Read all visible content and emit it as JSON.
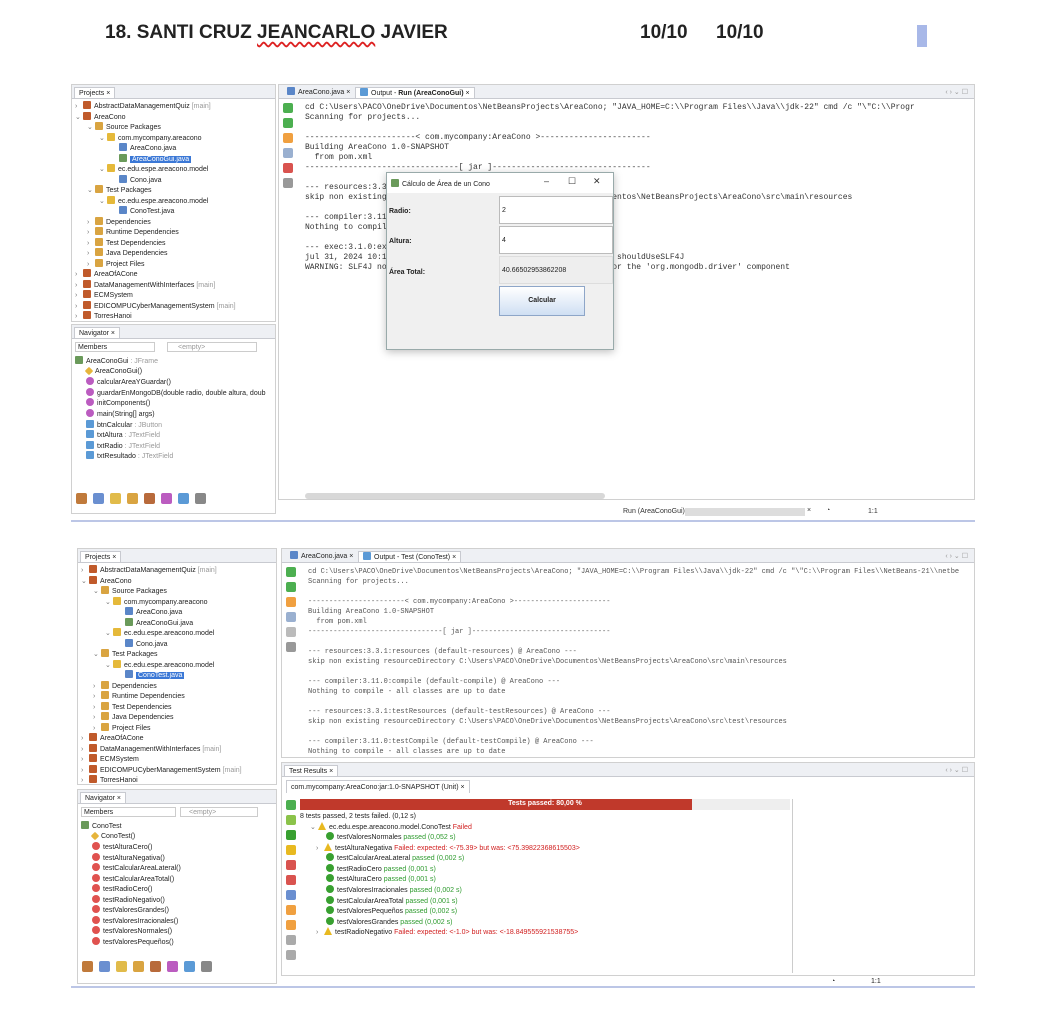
{
  "header": {
    "name_prefix": "18. SANTI CRUZ ",
    "name_underlined": "JEANCARLO",
    "name_suffix": " JAVIER",
    "grade1": "10/10",
    "grade2": "10/10"
  },
  "shot1": {
    "projects_tab": "Projects",
    "tree": [
      {
        "label": "AbstractDataManagementQuiz",
        "suffix": "[main]",
        "icon": "project-icon"
      },
      {
        "label": "AreaCono",
        "icon": "project-icon"
      },
      {
        "label": "Source Packages",
        "icon": "folder-icon"
      },
      {
        "label": "com.mycompany.areacono",
        "icon": "package-icon"
      },
      {
        "label": "AreaCono.java",
        "icon": "java-file-icon"
      },
      {
        "label": "AreaConoGui.java",
        "icon": "jframe-file-icon"
      },
      {
        "label": "ec.edu.espe.areacono.model",
        "icon": "package-icon"
      },
      {
        "label": "Cono.java",
        "icon": "java-file-icon"
      },
      {
        "label": "Test Packages",
        "icon": "folder-icon"
      },
      {
        "label": "ec.edu.espe.areacono.model",
        "icon": "package-icon"
      },
      {
        "label": "ConoTest.java",
        "icon": "java-file-icon"
      },
      {
        "label": "Dependencies",
        "icon": "library-icon"
      },
      {
        "label": "Runtime Dependencies",
        "icon": "library-icon"
      },
      {
        "label": "Test Dependencies",
        "icon": "library-icon"
      },
      {
        "label": "Java Dependencies",
        "icon": "library-icon"
      },
      {
        "label": "Project Files",
        "icon": "folder-icon"
      },
      {
        "label": "AreaOfACone",
        "icon": "project-icon"
      },
      {
        "label": "DataManagementWithInterfaces",
        "suffix": "[main]",
        "icon": "project-icon"
      },
      {
        "label": "ECMSystem",
        "icon": "project-icon"
      },
      {
        "label": "EDICOMPUCyberManagementSystem",
        "suffix": "[main]",
        "icon": "project-icon"
      },
      {
        "label": "TorresHanoi",
        "icon": "project-icon"
      }
    ],
    "navigator_tab": "Navigator",
    "members_label": "Members",
    "members_filter": "<empty>",
    "nav_items": [
      {
        "label": "AreaConoGui",
        "type": " : JFrame"
      },
      {
        "label": "AreaConoGui()",
        "type": ""
      },
      {
        "label": "calcularAreaYGuardar()",
        "type": ""
      },
      {
        "label": "guardarEnMongoDB(double radio, double altura, doub",
        "type": ""
      },
      {
        "label": "initComponents()",
        "type": ""
      },
      {
        "label": "main(String[] args)",
        "type": ""
      },
      {
        "label": "btnCalcular",
        "type": " : JButton"
      },
      {
        "label": "txtAltura",
        "type": " : JTextField"
      },
      {
        "label": "txtRadio",
        "type": " : JTextField"
      },
      {
        "label": "txtResultado",
        "type": " : JTextField"
      }
    ],
    "editor_tabs": [
      "AreaCono.java",
      "Output - "
    ],
    "output_tab_bold": "Run (AreaConoGui)",
    "output_lines": [
      "cd C:\\Users\\PACO\\OneDrive\\Documentos\\NetBeansProjects\\AreaCono; \"JAVA_HOME=C:\\\\Program Files\\\\Java\\\\jdk-22\" cmd /c \"\\\"C:\\\\Progr",
      "Scanning for projects...",
      "",
      "-----------------------< com.mycompany:AreaCono >-----------------------",
      "Building AreaCono 1.0-SNAPSHOT",
      "  from pom.xml",
      "--------------------------------[ jar ]---------------------------------",
      "",
      "--- resources:3.3.1:resources (default-resources) @ AreaCono ---",
      "skip non existing resourceDirectory C:\\Users\\PACO\\OneDrive\\Documentos\\NetBeansProjects\\AreaCono\\src\\main\\resources",
      "",
      "--- compiler:3.11.0:compile (default-compile) @ AreaCono ---",
      "Nothing to compile - all classes are up to date",
      "",
      "--- exec:3.1.0:exec (default-cli) @ AreaCono ---",
      "jul 31, 2024 10:13:44 AM com.mongodb.diagnostics.logging.Loggers shouldUseSLF4J",
      "WARNING: SLF4J not found on the classpath. Logging is disabled for the 'org.mongodb.driver' component"
    ],
    "dialog": {
      "title": "Cálculo de Área de un Cono",
      "radio_label": "Radio:",
      "radio_value": "2",
      "altura_label": "Altura:",
      "altura_value": "4",
      "area_label": "Área Total:",
      "area_value": "40.66502953862208",
      "button": "Calcular"
    },
    "status_run": "Run (AreaConoGui)",
    "status_pos": "1:1"
  },
  "shot2": {
    "projects_tab": "Projects",
    "tree": [
      {
        "label": "AbstractDataManagementQuiz",
        "suffix": "[main]",
        "icon": "project-icon"
      },
      {
        "label": "AreaCono",
        "icon": "project-icon"
      },
      {
        "label": "Source Packages",
        "icon": "folder-icon"
      },
      {
        "label": "com.mycompany.areacono",
        "icon": "package-icon"
      },
      {
        "label": "AreaCono.java",
        "icon": "java-file-icon"
      },
      {
        "label": "AreaConoGui.java",
        "icon": "jframe-file-icon"
      },
      {
        "label": "ec.edu.espe.areacono.model",
        "icon": "package-icon"
      },
      {
        "label": "Cono.java",
        "icon": "java-file-icon"
      },
      {
        "label": "Test Packages",
        "icon": "folder-icon"
      },
      {
        "label": "ec.edu.espe.areacono.model",
        "icon": "package-icon"
      },
      {
        "label": "ConoTest.java",
        "icon": "java-file-icon"
      },
      {
        "label": "Dependencies",
        "icon": "library-icon"
      },
      {
        "label": "Runtime Dependencies",
        "icon": "library-icon"
      },
      {
        "label": "Test Dependencies",
        "icon": "library-icon"
      },
      {
        "label": "Java Dependencies",
        "icon": "library-icon"
      },
      {
        "label": "Project Files",
        "icon": "folder-icon"
      },
      {
        "label": "AreaOfACone",
        "icon": "project-icon"
      },
      {
        "label": "DataManagementWithInterfaces",
        "suffix": "[main]",
        "icon": "project-icon"
      },
      {
        "label": "ECMSystem",
        "icon": "project-icon"
      },
      {
        "label": "EDICOMPUCyberManagementSystem",
        "suffix": "[main]",
        "icon": "project-icon"
      },
      {
        "label": "TorresHanoi",
        "icon": "project-icon"
      }
    ],
    "navigator_tab": "Navigator",
    "members_label": "Members",
    "members_filter": "<empty>",
    "nav_items": [
      "ConoTest",
      "ConoTest()",
      "testAlturaCero()",
      "testAlturaNegativa()",
      "testCalcularAreaLateral()",
      "testCalcularAreaTotal()",
      "testRadioCero()",
      "testRadioNegativo()",
      "testValoresGrandes()",
      "testValoresIrracionales()",
      "testValoresNormales()",
      "testValoresPequeños()"
    ],
    "editor_tabs": [
      "AreaCono.java",
      "Output - Test (ConoTest)"
    ],
    "output_lines": [
      "cd C:\\Users\\PACO\\OneDrive\\Documentos\\NetBeansProjects\\AreaCono; \"JAVA_HOME=C:\\\\Program Files\\\\Java\\\\jdk-22\" cmd /c \"\\\"C:\\\\Program Files\\\\NetBeans-21\\\\netbe",
      "Scanning for projects...",
      "",
      "-----------------------< com.mycompany:AreaCono >-----------------------",
      "Building AreaCono 1.0-SNAPSHOT",
      "  from pom.xml",
      "--------------------------------[ jar ]---------------------------------",
      "",
      "--- resources:3.3.1:resources (default-resources) @ AreaCono ---",
      "skip non existing resourceDirectory C:\\Users\\PACO\\OneDrive\\Documentos\\NetBeansProjects\\AreaCono\\src\\main\\resources",
      "",
      "--- compiler:3.11.0:compile (default-compile) @ AreaCono ---",
      "Nothing to compile - all classes are up to date",
      "",
      "--- resources:3.3.1:testResources (default-testResources) @ AreaCono ---",
      "skip non existing resourceDirectory C:\\Users\\PACO\\OneDrive\\Documentos\\NetBeansProjects\\AreaCono\\src\\test\\resources",
      "",
      "--- compiler:3.11.0:testCompile (default-testCompile) @ AreaCono ---",
      "Nothing to compile - all classes are up to date"
    ],
    "test_results_tab": "Test Results",
    "suite_tab": "com.mycompany:AreaCono:jar:1.0-SNAPSHOT (Unit)",
    "progress_label": "Tests passed: 80,00 %",
    "progress_percent": 80,
    "summary": "8 tests passed, 2 tests failed. (0,12 s)",
    "suite_name": "ec.edu.espe.areacono.model.ConoTest",
    "suite_status": "Failed",
    "tests": [
      {
        "name": "testValoresNormales",
        "status": "passed",
        "detail": "(0,052 s)"
      },
      {
        "name": "testAlturaNegativa",
        "status": "failed",
        "detail": "Failed: expected: <-75.39> but was: <75.39822368615503>"
      },
      {
        "name": "testCalcularAreaLateral",
        "status": "passed",
        "detail": "(0,002 s)"
      },
      {
        "name": "testRadioCero",
        "status": "passed",
        "detail": "(0,001 s)"
      },
      {
        "name": "testAlturaCero",
        "status": "passed",
        "detail": "(0,001 s)"
      },
      {
        "name": "testValoresIrracionales",
        "status": "passed",
        "detail": "(0,002 s)"
      },
      {
        "name": "testCalcularAreaTotal",
        "status": "passed",
        "detail": "(0,001 s)"
      },
      {
        "name": "testValoresPequeños",
        "status": "passed",
        "detail": "(0,002 s)"
      },
      {
        "name": "testValoresGrandes",
        "status": "passed",
        "detail": "(0,002 s)"
      },
      {
        "name": "testRadioNegativo",
        "status": "failed",
        "detail": "Failed: expected: <-1.0> but was: <-18.849555921538755>"
      }
    ],
    "status_pos": "1:1"
  },
  "colors": {
    "accent": "#3b78d6",
    "fail": "#d12020",
    "pass": "#2d9a2d",
    "progress": "#c0392b"
  }
}
